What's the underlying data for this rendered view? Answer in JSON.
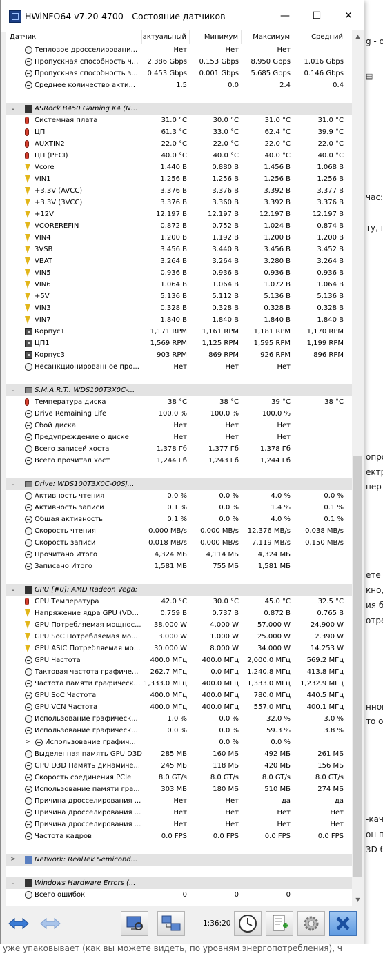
{
  "window": {
    "title": "HWiNFO64 v7.20-4700 - Состояние датчиков",
    "controls": {
      "minimize": "—",
      "maximize": "☐",
      "close": "✕"
    }
  },
  "columns": {
    "sensor": "Датчик",
    "current": "актуальный",
    "min": "Минимум",
    "max": "Максимум",
    "avg": "Средний"
  },
  "rows": [
    {
      "type": "sensor",
      "icon": "clock",
      "label": "Тепловое дросселировани...",
      "cur": "Нет",
      "min": "Нет",
      "max": "Нет",
      "avg": ""
    },
    {
      "type": "sensor",
      "icon": "clock",
      "label": "Пропускная способность ч...",
      "cur": "2.386 Gbps",
      "min": "0.153 Gbps",
      "max": "8.950 Gbps",
      "avg": "1.016 Gbps"
    },
    {
      "type": "sensor",
      "icon": "clock",
      "label": "Пропускная способность з...",
      "cur": "0.453 Gbps",
      "min": "0.001 Gbps",
      "max": "5.685 Gbps",
      "avg": "0.146 Gbps"
    },
    {
      "type": "sensor",
      "icon": "clock",
      "label": "Среднее количество акти...",
      "cur": "1.5",
      "min": "0.0",
      "max": "2.4",
      "avg": "0.4"
    },
    {
      "type": "blank"
    },
    {
      "type": "group",
      "icon": "chip",
      "expander": "down",
      "label": "ASRock B450 Gaming K4 (Nu..."
    },
    {
      "type": "sensor",
      "icon": "therm",
      "label": "Системная плата",
      "cur": "31.0 °C",
      "min": "30.0 °C",
      "max": "31.0 °C",
      "avg": "31.0 °C"
    },
    {
      "type": "sensor",
      "icon": "therm",
      "label": "ЦП",
      "cur": "61.3 °C",
      "min": "33.0 °C",
      "max": "62.4 °C",
      "avg": "39.9 °C"
    },
    {
      "type": "sensor",
      "icon": "therm",
      "label": "AUXTIN2",
      "cur": "22.0 °C",
      "min": "22.0 °C",
      "max": "22.0 °C",
      "avg": "22.0 °C"
    },
    {
      "type": "sensor",
      "icon": "therm",
      "label": "ЦП (PECI)",
      "cur": "40.0 °C",
      "min": "40.0 °C",
      "max": "40.0 °C",
      "avg": "40.0 °C"
    },
    {
      "type": "sensor",
      "icon": "volt",
      "label": "Vcore",
      "cur": "1.440 В",
      "min": "0.880 В",
      "max": "1.456 В",
      "avg": "1.068 В"
    },
    {
      "type": "sensor",
      "icon": "volt",
      "label": "VIN1",
      "cur": "1.256 В",
      "min": "1.256 В",
      "max": "1.256 В",
      "avg": "1.256 В"
    },
    {
      "type": "sensor",
      "icon": "volt",
      "label": "+3.3V (AVCC)",
      "cur": "3.376 В",
      "min": "3.376 В",
      "max": "3.392 В",
      "avg": "3.377 В"
    },
    {
      "type": "sensor",
      "icon": "volt",
      "label": "+3.3V (3VCC)",
      "cur": "3.376 В",
      "min": "3.360 В",
      "max": "3.392 В",
      "avg": "3.376 В"
    },
    {
      "type": "sensor",
      "icon": "volt",
      "label": "+12V",
      "cur": "12.197 В",
      "min": "12.197 В",
      "max": "12.197 В",
      "avg": "12.197 В"
    },
    {
      "type": "sensor",
      "icon": "volt",
      "label": "VCOREREFIN",
      "cur": "0.872 В",
      "min": "0.752 В",
      "max": "1.024 В",
      "avg": "0.874 В"
    },
    {
      "type": "sensor",
      "icon": "volt",
      "label": "VIN4",
      "cur": "1.200 В",
      "min": "1.192 В",
      "max": "1.200 В",
      "avg": "1.200 В"
    },
    {
      "type": "sensor",
      "icon": "volt",
      "label": "3VSB",
      "cur": "3.456 В",
      "min": "3.440 В",
      "max": "3.456 В",
      "avg": "3.452 В"
    },
    {
      "type": "sensor",
      "icon": "volt",
      "label": "VBAT",
      "cur": "3.264 В",
      "min": "3.264 В",
      "max": "3.280 В",
      "avg": "3.264 В"
    },
    {
      "type": "sensor",
      "icon": "volt",
      "label": "VIN5",
      "cur": "0.936 В",
      "min": "0.936 В",
      "max": "0.936 В",
      "avg": "0.936 В"
    },
    {
      "type": "sensor",
      "icon": "volt",
      "label": "VIN6",
      "cur": "1.064 В",
      "min": "1.064 В",
      "max": "1.072 В",
      "avg": "1.064 В"
    },
    {
      "type": "sensor",
      "icon": "volt",
      "label": "+5V",
      "cur": "5.136 В",
      "min": "5.112 В",
      "max": "5.136 В",
      "avg": "5.136 В"
    },
    {
      "type": "sensor",
      "icon": "volt",
      "label": "VIN3",
      "cur": "0.328 В",
      "min": "0.328 В",
      "max": "0.328 В",
      "avg": "0.328 В"
    },
    {
      "type": "sensor",
      "icon": "volt",
      "label": "VIN7",
      "cur": "1.840 В",
      "min": "1.840 В",
      "max": "1.840 В",
      "avg": "1.840 В"
    },
    {
      "type": "sensor",
      "icon": "fan",
      "label": "Корпус1",
      "cur": "1,171 RPM",
      "min": "1,161 RPM",
      "max": "1,181 RPM",
      "avg": "1,170 RPM"
    },
    {
      "type": "sensor",
      "icon": "fan",
      "label": "ЦП1",
      "cur": "1,569 RPM",
      "min": "1,125 RPM",
      "max": "1,595 RPM",
      "avg": "1,199 RPM"
    },
    {
      "type": "sensor",
      "icon": "fan",
      "label": "Корпус3",
      "cur": "903 RPM",
      "min": "869 RPM",
      "max": "926 RPM",
      "avg": "896 RPM"
    },
    {
      "type": "sensor",
      "icon": "clock",
      "label": "Несанкционированное про...",
      "cur": "Нет",
      "min": "Нет",
      "max": "Нет",
      "avg": ""
    },
    {
      "type": "blank"
    },
    {
      "type": "group",
      "icon": "drive",
      "expander": "down",
      "label": "S.M.A.R.T.: WDS100T3X0C-..."
    },
    {
      "type": "sensor",
      "icon": "therm",
      "label": "Температура диска",
      "cur": "38 °C",
      "min": "38 °C",
      "max": "39 °C",
      "avg": "38 °C"
    },
    {
      "type": "sensor",
      "icon": "clock",
      "label": "Drive Remaining Life",
      "cur": "100.0 %",
      "min": "100.0 %",
      "max": "100.0 %",
      "avg": ""
    },
    {
      "type": "sensor",
      "icon": "clock",
      "label": "Сбой диска",
      "cur": "Нет",
      "min": "Нет",
      "max": "Нет",
      "avg": ""
    },
    {
      "type": "sensor",
      "icon": "clock",
      "label": "Предупреждение о диске",
      "cur": "Нет",
      "min": "Нет",
      "max": "Нет",
      "avg": ""
    },
    {
      "type": "sensor",
      "icon": "clock",
      "label": "Всего записей хоста",
      "cur": "1,378 Гб",
      "min": "1,377 Гб",
      "max": "1,378 Гб",
      "avg": ""
    },
    {
      "type": "sensor",
      "icon": "clock",
      "label": "Всего прочитал хост",
      "cur": "1,244 Гб",
      "min": "1,243 Гб",
      "max": "1,244 Гб",
      "avg": ""
    },
    {
      "type": "blank"
    },
    {
      "type": "group",
      "icon": "drive",
      "expander": "down",
      "label": "Drive: WDS100T3X0C-00SJG..."
    },
    {
      "type": "sensor",
      "icon": "clock",
      "label": "Активность чтения",
      "cur": "0.0 %",
      "min": "0.0 %",
      "max": "4.0 %",
      "avg": "0.0 %"
    },
    {
      "type": "sensor",
      "icon": "clock",
      "label": "Активность записи",
      "cur": "0.1 %",
      "min": "0.0 %",
      "max": "1.4 %",
      "avg": "0.1 %"
    },
    {
      "type": "sensor",
      "icon": "clock",
      "label": "Общая активность",
      "cur": "0.1 %",
      "min": "0.0 %",
      "max": "4.0 %",
      "avg": "0.1 %"
    },
    {
      "type": "sensor",
      "icon": "clock",
      "label": "Скорость чтения",
      "cur": "0.000 MB/s",
      "min": "0.000 MB/s",
      "max": "12.376 MB/s",
      "avg": "0.038 MB/s"
    },
    {
      "type": "sensor",
      "icon": "clock",
      "label": "Скорость записи",
      "cur": "0.018 MB/s",
      "min": "0.000 MB/s",
      "max": "7.119 MB/s",
      "avg": "0.150 MB/s"
    },
    {
      "type": "sensor",
      "icon": "clock",
      "label": "Прочитано Итого",
      "cur": "4,324 МБ",
      "min": "4,114 МБ",
      "max": "4,324 МБ",
      "avg": ""
    },
    {
      "type": "sensor",
      "icon": "clock",
      "label": "Записано Итого",
      "cur": "1,581 МБ",
      "min": "755 МБ",
      "max": "1,581 МБ",
      "avg": ""
    },
    {
      "type": "blank"
    },
    {
      "type": "group",
      "icon": "chip",
      "expander": "down",
      "label": "GPU [#0]: AMD Radeon Vega:"
    },
    {
      "type": "sensor",
      "icon": "therm",
      "label": "GPU Температура",
      "cur": "42.0 °C",
      "min": "30.0 °C",
      "max": "45.0 °C",
      "avg": "32.5 °C"
    },
    {
      "type": "sensor",
      "icon": "volt",
      "label": "Напряжение ядра GPU (VD...",
      "cur": "0.759 В",
      "min": "0.737 В",
      "max": "0.872 В",
      "avg": "0.765 В"
    },
    {
      "type": "sensor",
      "icon": "volt",
      "label": "GPU Потребляемая мощнос...",
      "cur": "38.000 W",
      "min": "4.000 W",
      "max": "57.000 W",
      "avg": "24.900 W"
    },
    {
      "type": "sensor",
      "icon": "volt",
      "label": "GPU SoC Потребляемая мо...",
      "cur": "3.000 W",
      "min": "1.000 W",
      "max": "25.000 W",
      "avg": "2.390 W"
    },
    {
      "type": "sensor",
      "icon": "volt",
      "label": "GPU ASIC Потребляемая мо...",
      "cur": "30.000 W",
      "min": "8.000 W",
      "max": "34.000 W",
      "avg": "14.253 W"
    },
    {
      "type": "sensor",
      "icon": "clock",
      "label": "GPU Частота",
      "cur": "400.0 МГц",
      "min": "400.0 МГц",
      "max": "2,000.0 МГц",
      "avg": "569.2 МГц"
    },
    {
      "type": "sensor",
      "icon": "clock",
      "label": "Тактовая частота графиче...",
      "cur": "262.7 МГц",
      "min": "0.0 МГц",
      "max": "1,240.8 МГц",
      "avg": "413.8 МГц"
    },
    {
      "type": "sensor",
      "icon": "clock",
      "label": "Частота памяти графическ...",
      "cur": "1,333.0 МГц",
      "min": "400.0 МГц",
      "max": "1,333.0 МГц",
      "avg": "1,232.9 МГц"
    },
    {
      "type": "sensor",
      "icon": "clock",
      "label": "GPU SoC Частота",
      "cur": "400.0 МГц",
      "min": "400.0 МГц",
      "max": "780.0 МГц",
      "avg": "440.5 МГц"
    },
    {
      "type": "sensor",
      "icon": "clock",
      "label": "GPU VCN Частота",
      "cur": "400.0 МГц",
      "min": "400.0 МГц",
      "max": "557.0 МГц",
      "avg": "400.1 МГц"
    },
    {
      "type": "sensor",
      "icon": "clock",
      "label": "Использование графическ...",
      "cur": "1.0 %",
      "min": "0.0 %",
      "max": "32.0 %",
      "avg": "3.0 %"
    },
    {
      "type": "sensor",
      "icon": "clock",
      "label": "Использование графическ...",
      "cur": "0.0 %",
      "min": "0.0 %",
      "max": "59.3 %",
      "avg": "3.8 %"
    },
    {
      "type": "sensor",
      "icon": "clock",
      "expander": "right",
      "label": "Использование графич...",
      "cur": "",
      "min": "0.0 %",
      "max": "0.0 %",
      "avg": ""
    },
    {
      "type": "sensor",
      "icon": "clock",
      "label": "Выделенная память GPU D3D",
      "cur": "285 МБ",
      "min": "160 МБ",
      "max": "492 МБ",
      "avg": "261 МБ"
    },
    {
      "type": "sensor",
      "icon": "clock",
      "label": "GPU D3D Память динамиче...",
      "cur": "245 МБ",
      "min": "118 МБ",
      "max": "420 МБ",
      "avg": "156 МБ"
    },
    {
      "type": "sensor",
      "icon": "clock",
      "label": "Скорость соединения PCIe",
      "cur": "8.0 GT/s",
      "min": "8.0 GT/s",
      "max": "8.0 GT/s",
      "avg": "8.0 GT/s"
    },
    {
      "type": "sensor",
      "icon": "clock",
      "label": "Использование памяти гра...",
      "cur": "303 МБ",
      "min": "180 МБ",
      "max": "510 МБ",
      "avg": "274 МБ"
    },
    {
      "type": "sensor",
      "icon": "clock",
      "label": "Причина дросселирования ...",
      "cur": "Нет",
      "min": "Нет",
      "max": "да",
      "avg": "да"
    },
    {
      "type": "sensor",
      "icon": "clock",
      "label": "Причина дросселирования ...",
      "cur": "Нет",
      "min": "Нет",
      "max": "Нет",
      "avg": "Нет"
    },
    {
      "type": "sensor",
      "icon": "clock",
      "label": "Причина дросселирования ...",
      "cur": "Нет",
      "min": "Нет",
      "max": "Нет",
      "avg": "Нет"
    },
    {
      "type": "sensor",
      "icon": "clock",
      "label": "Частота кадров",
      "cur": "0.0 FPS",
      "min": "0.0 FPS",
      "max": "0.0 FPS",
      "avg": "0.0 FPS"
    },
    {
      "type": "blank"
    },
    {
      "type": "group",
      "icon": "net",
      "expander": "right",
      "label": "Network: RealTek Semicond..."
    },
    {
      "type": "blank"
    },
    {
      "type": "group",
      "icon": "win",
      "expander": "down",
      "label": "Windows Hardware Errors (..."
    },
    {
      "type": "sensor",
      "icon": "clock",
      "label": "Всего ошибок",
      "cur": "0",
      "min": "0",
      "max": "0",
      "avg": ""
    }
  ],
  "toolbar": {
    "timer": "1:36:20"
  },
  "background_page": {
    "fragments": [
      "g - o",
      "час:",
      "ту, н",
      "к",
      "т",
      "опро",
      "ектр",
      "пер",
      "ете п",
      "кно,",
      "ия бу",
      "отре",
      "нном",
      "то о",
      "-кач",
      "он по",
      "3D б",
      "3(",
      "и",
      "уже упаковывает (как вы можете видеть, по уровням энергопотребления), ч"
    ]
  }
}
